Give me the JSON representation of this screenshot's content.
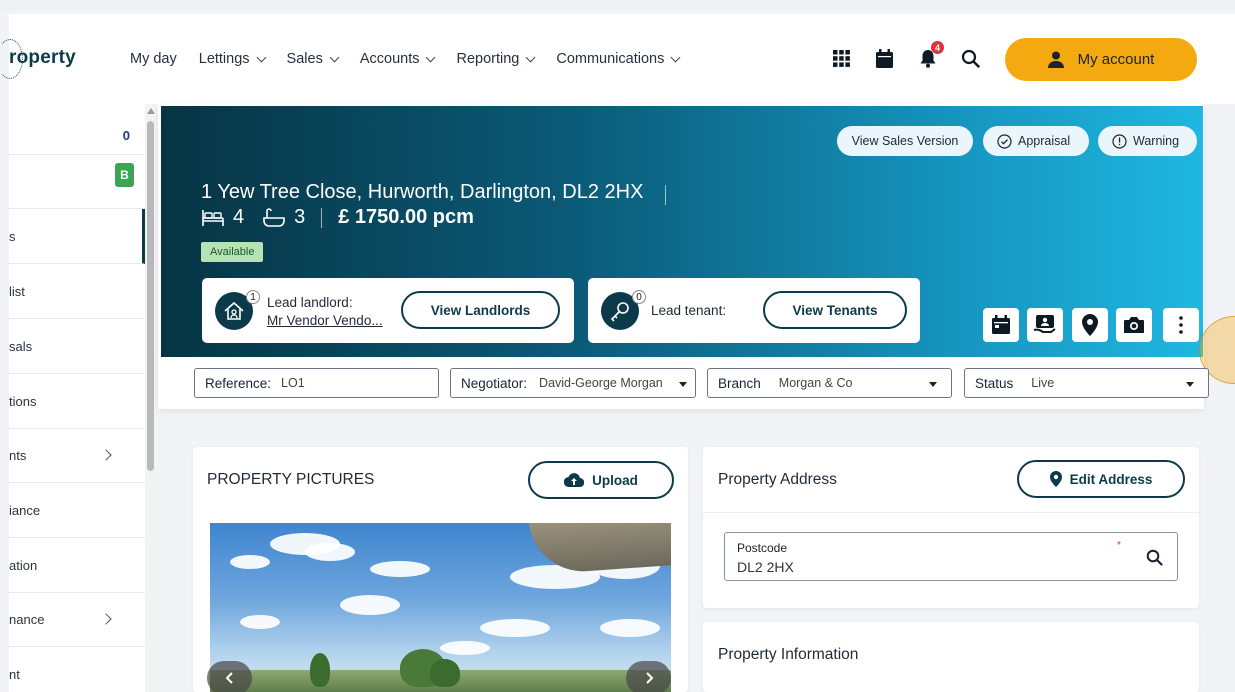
{
  "header": {
    "logo_text": "roperty",
    "nav": [
      "My day",
      "Lettings",
      "Sales",
      "Accounts",
      "Reporting",
      "Communications"
    ],
    "nav_has_dropdown": [
      false,
      true,
      true,
      true,
      true,
      true
    ],
    "notification_count": "4",
    "account_label": "My account"
  },
  "sidebar": {
    "count_value": "0",
    "badge_letter": "B",
    "items": [
      {
        "label": "s",
        "chevron": false,
        "active": true
      },
      {
        "label": "list",
        "chevron": false
      },
      {
        "label": "sals",
        "chevron": false
      },
      {
        "label": "tions",
        "chevron": false
      },
      {
        "label": "nts",
        "chevron": true
      },
      {
        "label": "iance",
        "chevron": false
      },
      {
        "label": "ation",
        "chevron": false
      },
      {
        "label": "nance",
        "chevron": true
      },
      {
        "label": "nt",
        "chevron": false
      }
    ]
  },
  "hero": {
    "buttons": [
      "View Sales Version",
      "Appraisal",
      "Warning"
    ],
    "address": "1 Yew Tree Close, Hurworth, Darlington, DL2 2HX",
    "bedrooms": "4",
    "bathrooms": "3",
    "price": "£ 1750.00 pcm",
    "status_tag": "Available",
    "landlord": {
      "count": "1",
      "label": "Lead landlord:",
      "name": "Mr Vendor Vendo...",
      "button": "View Landlords"
    },
    "tenant": {
      "count": "0",
      "label": "Lead tenant:",
      "button": "View Tenants"
    }
  },
  "filters": {
    "reference": {
      "label": "Reference:",
      "value": "LO1"
    },
    "negotiator": {
      "label": "Negotiator:",
      "value": "David-George Morgan"
    },
    "branch": {
      "label": "Branch",
      "value": "Morgan & Co"
    },
    "status": {
      "label": "Status",
      "value": "Live"
    }
  },
  "pictures": {
    "title": "PROPERTY PICTURES",
    "upload_label": "Upload"
  },
  "address_panel": {
    "title": "Property Address",
    "edit_label": "Edit Address",
    "postcode_label": "Postcode",
    "postcode_value": "DL2 2HX",
    "required_mark": "*"
  },
  "info_panel": {
    "title": "Property Information"
  },
  "colors": {
    "primary": "#0d3a4a",
    "accent": "#f5a910",
    "hero_start": "#063443",
    "hero_end": "#1fb7e0",
    "available": "#b5e3b3"
  }
}
